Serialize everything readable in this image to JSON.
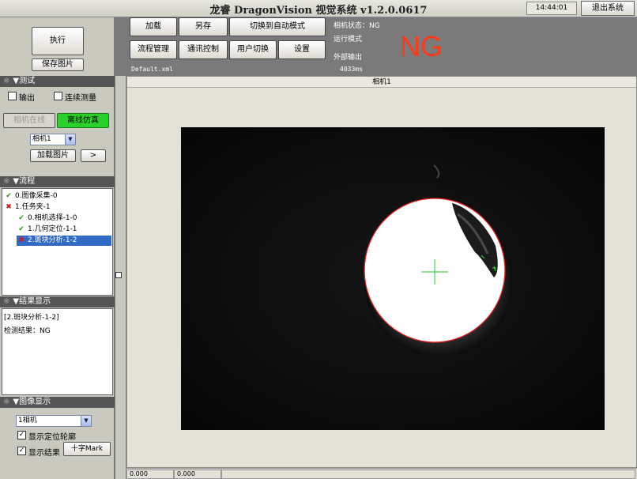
{
  "app": {
    "title": "龙睿 DragonVision 视觉系统 v1.2.0.0617",
    "time": "14:44:01",
    "exit_label": "退出系统"
  },
  "left": {
    "run_label": "执行",
    "save_image_label": "保存图片",
    "test": {
      "header": "▼测试",
      "output_label": "输出",
      "continuous_label": "连续测量",
      "camera_online_label": "相机在线",
      "offline_sim_label": "离线仿真",
      "camera_select": "相机1",
      "load_image_label": "加载图片",
      "next_label": ">"
    },
    "flow": {
      "header": "▼流程",
      "items": [
        {
          "label": "0.图像采集-0",
          "status": "ok"
        },
        {
          "label": "1.任务夹-1",
          "status": "ng"
        },
        {
          "label": "0.相机选择-1-0",
          "status": "ok"
        },
        {
          "label": "1.几何定位-1-1",
          "status": "ok"
        },
        {
          "label": "2.斑块分析-1-2",
          "status": "ng"
        }
      ]
    },
    "result": {
      "header": "▼结果显示",
      "line1": "[2.斑块分析-1-2]",
      "line2": "检测结果：NG"
    },
    "display": {
      "header": "▼图像显示",
      "camera_select": "1相机",
      "show_contour_label": "显示定位轮廓",
      "show_result_label": "显示结果",
      "crosshair_label": "十字Mark"
    }
  },
  "toolbar": {
    "load": "加载",
    "save_as": "另存",
    "switch_auto": "切换到自动模式",
    "flow_manage": "流程管理",
    "comm_control": "通讯控制",
    "user_switch": "用户切换",
    "settings": "设置",
    "file_name": "Default.xml",
    "elapsed": "4033ms",
    "camera_status_label": "相机状态：NG",
    "run_mode_label": "运行模式",
    "external_output_label": "外部输出",
    "result_big": "NG"
  },
  "view": {
    "title": "相机1",
    "coord_x": "0.000",
    "coord_y": "0.000"
  },
  "colors": {
    "ng": "#ff3a1a",
    "ok": "#2a9a1a",
    "selected": "#316ac5",
    "contour": "#e02020",
    "crosshair": "#22cc22"
  }
}
